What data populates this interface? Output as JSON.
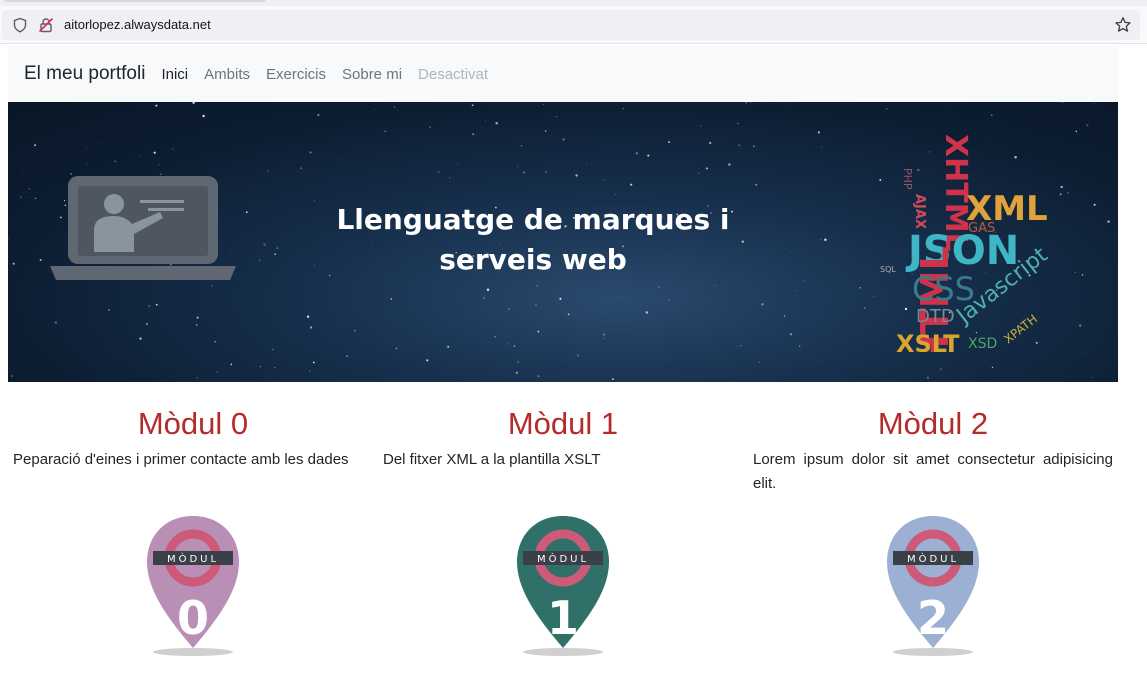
{
  "browser": {
    "url": "aitorlopez.alwaysdata.net",
    "icons": [
      "shield-icon",
      "lock-icon",
      "star-icon"
    ]
  },
  "navbar": {
    "brand": "El meu portfoli",
    "links": [
      {
        "label": "Inici",
        "state": "active"
      },
      {
        "label": "Ambits",
        "state": "normal"
      },
      {
        "label": "Exercicis",
        "state": "normal"
      },
      {
        "label": "Sobre mi",
        "state": "normal"
      },
      {
        "label": "Desactivat",
        "state": "disabled"
      }
    ]
  },
  "banner": {
    "title_line1": "Llenguatge de marques i",
    "title_line2": "serveis web",
    "cloud_words": [
      "XML",
      "JSON",
      "XHTML",
      "HTML",
      "CSS",
      "XSLT",
      "Javascript",
      "DTD",
      "XSD",
      "XPATH",
      "AJAX",
      "PHP",
      "GAS",
      "SQL"
    ]
  },
  "modules": [
    {
      "title": "Mòdul 0",
      "description": "Peparació d'eines i primer contacte amb les dades",
      "badge_label": "MÒDUL",
      "badge_number": "0",
      "color": "#b98fb5"
    },
    {
      "title": "Mòdul 1",
      "description": "Del fitxer XML a la plantilla XSLT",
      "badge_label": "MÒDUL",
      "badge_number": "1",
      "color": "#2f7068"
    },
    {
      "title": "Mòdul 2",
      "description": "Lorem ipsum dolor sit amet consectetur adipisicing elit.",
      "badge_label": "MÒDUL",
      "badge_number": "2",
      "color": "#9bb0d2"
    }
  ],
  "colors": {
    "accent_title": "#b52a2a",
    "navbar_bg": "#f8f9fa",
    "ring": "#cc5a78",
    "band": "#3a3f48"
  }
}
